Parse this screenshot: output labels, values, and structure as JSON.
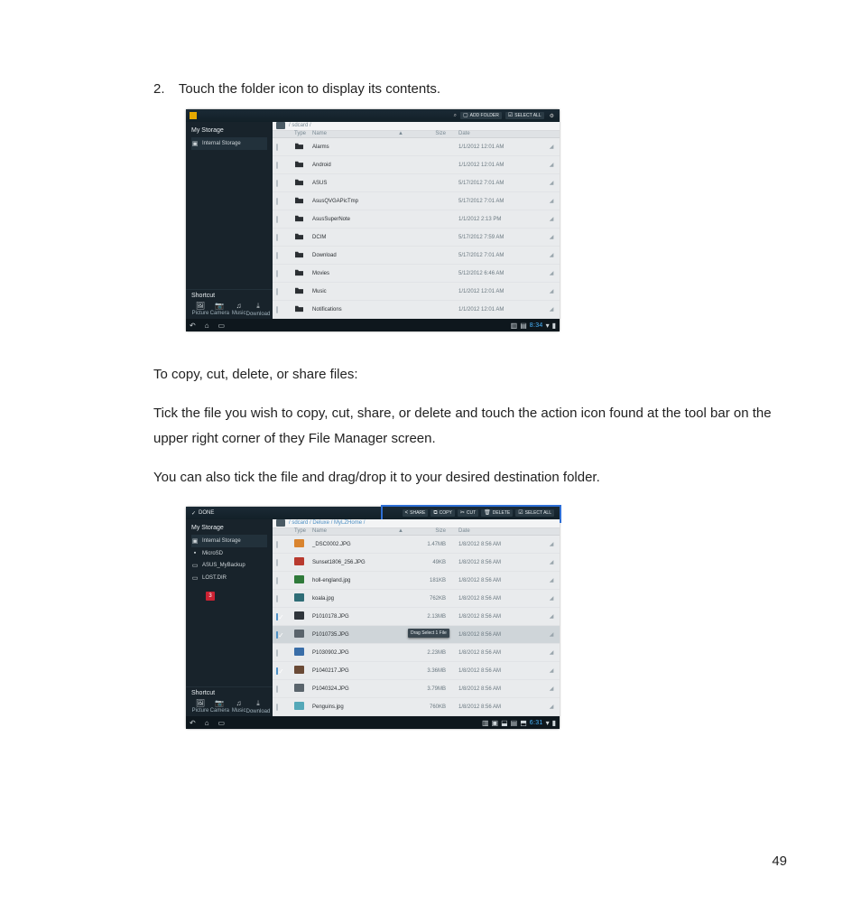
{
  "page_number": "49",
  "step": {
    "num": "2.",
    "text": "Touch the folder icon to display its contents."
  },
  "para1_heading": "To copy, cut, delete, or share files:",
  "para2": "Tick the file you wish to copy, cut, share, or delete and touch the action icon found at the tool bar on the upper right corner of they File Manager screen.",
  "para3": "You can also tick the file and drag/drop it to your desired destination folder.",
  "shot1": {
    "topbar": {
      "search_icon": "⌕",
      "add_folder_label": "ADD FOLDER",
      "select_all_label": "SELECT ALL",
      "settings_icon": "⚙"
    },
    "sidebar": {
      "title": "My Storage",
      "items": [
        {
          "icon": "▣",
          "label": "Internal Storage",
          "selected": true
        }
      ],
      "shortcut_title": "Shortcut",
      "shortcuts": [
        {
          "icon": "🖼",
          "label": "Picture"
        },
        {
          "icon": "📷",
          "label": "Camera"
        },
        {
          "icon": "♫",
          "label": "Music"
        },
        {
          "icon": "⤓",
          "label": "Download"
        }
      ]
    },
    "breadcrumb": "/ sdcard /",
    "columns": {
      "type": "Type",
      "name": "Name",
      "sort": "▲",
      "size": "Size",
      "date": "Date"
    },
    "rows": [
      {
        "name": "Alarms",
        "date": "1/1/2012 12:01 AM"
      },
      {
        "name": "Android",
        "date": "1/1/2012 12:01 AM"
      },
      {
        "name": "ASUS",
        "date": "5/17/2012 7:01 AM"
      },
      {
        "name": "AsusQVGAPicTmp",
        "date": "5/17/2012 7:01 AM"
      },
      {
        "name": "AsusSuperNote",
        "date": "1/1/2012 2:13 PM"
      },
      {
        "name": "DCIM",
        "date": "5/17/2012 7:59 AM"
      },
      {
        "name": "Download",
        "date": "5/17/2012 7:01 AM"
      },
      {
        "name": "Movies",
        "date": "5/12/2012 6:46 AM"
      },
      {
        "name": "Music",
        "date": "1/1/2012 12:01 AM"
      },
      {
        "name": "Notifications",
        "date": "1/1/2012 12:01 AM"
      }
    ],
    "navbar_time": "8:34",
    "tail_glyph": "◢"
  },
  "shot2": {
    "topbar": {
      "done_label": "DONE",
      "actions": [
        {
          "icon": "<",
          "label": "SHARE"
        },
        {
          "icon": "⧉",
          "label": "COPY"
        },
        {
          "icon": "✂",
          "label": "CUT"
        },
        {
          "icon": "🗑",
          "label": "DELETE"
        },
        {
          "icon": "☑",
          "label": "SELECT ALL"
        }
      ]
    },
    "sidebar": {
      "title": "My Storage",
      "items": [
        {
          "icon": "▣",
          "label": "Internal Storage",
          "selected": true
        },
        {
          "icon": "▪",
          "label": "MicroSD"
        },
        {
          "icon": "▭",
          "label": "ASUS_MyBackup"
        },
        {
          "icon": "▭",
          "label": "LOST.DIR"
        }
      ],
      "badge": "3",
      "shortcut_title": "Shortcut",
      "shortcuts": [
        {
          "icon": "🖼",
          "label": "Picture"
        },
        {
          "icon": "📷",
          "label": "Camera"
        },
        {
          "icon": "♫",
          "label": "Music"
        },
        {
          "icon": "⤓",
          "label": "Download"
        }
      ]
    },
    "breadcrumb": "/ sdcard / Deluxe / MyLZHome /",
    "columns": {
      "type": "Type",
      "name": "Name",
      "sort": "▲",
      "size": "Size",
      "date": "Date"
    },
    "drag_chip": "Drag Select\n1 File",
    "rows": [
      {
        "chk": false,
        "thumb": "orange",
        "name": "_DSC0002.JPG",
        "size": "1.47MB",
        "date": "1/8/2012 8:56 AM"
      },
      {
        "chk": false,
        "thumb": "red",
        "name": "Sunset1806_256.JPG",
        "size": "49KB",
        "date": "1/8/2012 8:56 AM"
      },
      {
        "chk": false,
        "thumb": "green",
        "name": "holl-england.jpg",
        "size": "181KB",
        "date": "1/8/2012 8:56 AM"
      },
      {
        "chk": false,
        "thumb": "teal",
        "name": "koala.jpg",
        "size": "762KB",
        "date": "1/8/2012 8:56 AM"
      },
      {
        "chk": true,
        "thumb": "dark",
        "name": "P1010178.JPG",
        "size": "2.13MB",
        "date": "1/8/2012 8:56 AM"
      },
      {
        "chk": true,
        "thumb": "gray2",
        "name": "P1010735.JPG",
        "size": "",
        "date": "1/8/2012 8:56 AM",
        "drag": true
      },
      {
        "chk": false,
        "thumb": "blue",
        "name": "P1030902.JPG",
        "size": "2.23MB",
        "date": "1/8/2012 8:56 AM"
      },
      {
        "chk": true,
        "thumb": "brown",
        "name": "P1040217.JPG",
        "size": "3.36MB",
        "date": "1/8/2012 8:56 AM"
      },
      {
        "chk": false,
        "thumb": "gray2",
        "name": "P1040324.JPG",
        "size": "3.79MB",
        "date": "1/8/2012 8:56 AM"
      },
      {
        "chk": false,
        "thumb": "cyan",
        "name": "Penguins.jpg",
        "size": "760KB",
        "date": "1/8/2012 8:56 AM"
      }
    ],
    "navbar_time": "6:31",
    "tail_glyph": "◢"
  }
}
